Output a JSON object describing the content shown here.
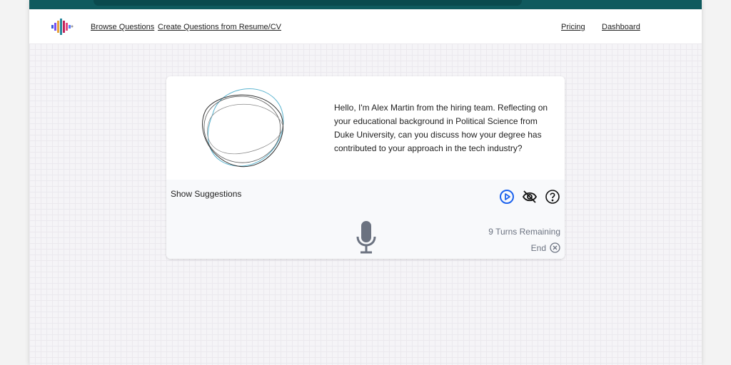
{
  "nav": {
    "browse": "Browse Questions",
    "create": "Create Questions from Resume/CV",
    "pricing": "Pricing",
    "dashboard": "Dashboard"
  },
  "interview": {
    "question": "Hello, I'm Alex Martin from the hiring team. Reflecting on your educational background in Political Science from Duke University, can you discuss how your degree has contributed to your approach in the tech industry?",
    "show_suggestions": "Show Suggestions",
    "turns_remaining": "9 Turns Remaining",
    "end_label": "End"
  },
  "colors": {
    "accent": "#1d63ed",
    "chrome": "#0f5a5e",
    "muted": "#6b7280"
  }
}
